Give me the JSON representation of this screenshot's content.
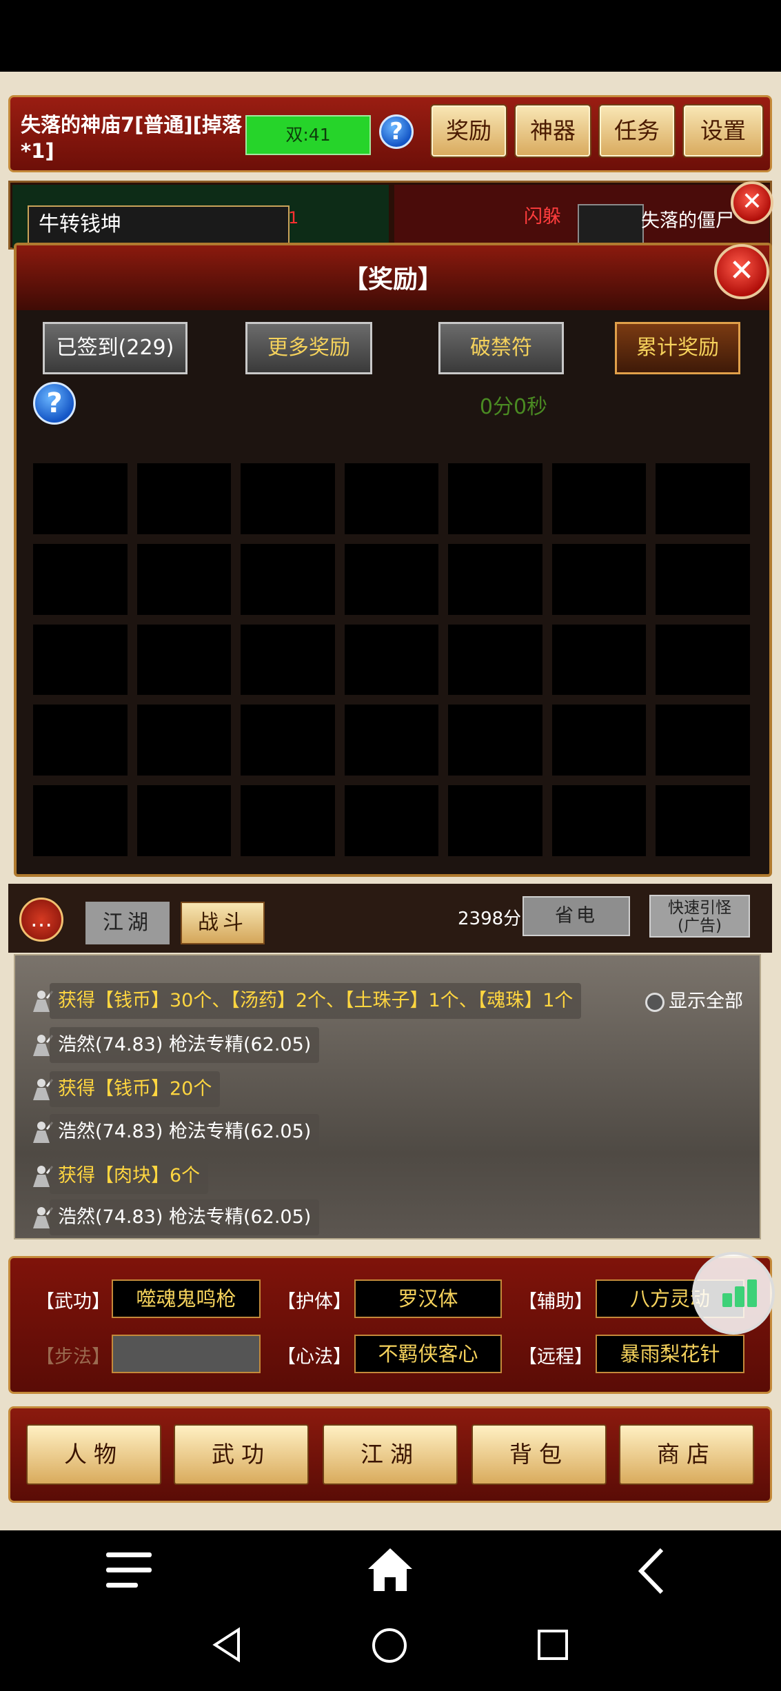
{
  "header": {
    "map_title": "失落的神庙7[普通][掉落*1]",
    "double_text": "双:41",
    "help_symbol": "?",
    "buttons": [
      "奖励",
      "神器",
      "任务",
      "设置"
    ]
  },
  "battle": {
    "ally_name": "牛转钱坤",
    "ally_marker": "1",
    "dodge_text": "闪躲",
    "enemy_name": "失落的僵尸"
  },
  "modal": {
    "title": "【奖励】",
    "tabs": [
      "已签到(229)",
      "更多奖励",
      "破禁符",
      "累计奖励"
    ],
    "timer": "0分0秒",
    "grid_rows": 5,
    "grid_cols": 7
  },
  "chat": {
    "tabs": [
      "江湖",
      "战斗"
    ],
    "score": "2398分",
    "save_button": "省电",
    "quick_button": "快速引怪\n(广告)",
    "show_all": "显示全部",
    "logs": [
      {
        "text": "获得【钱币】30个、【汤药】2个、【土珠子】1个、【魂珠】1个",
        "type": "gold"
      },
      {
        "text": "浩然(74.83) 枪法专精(62.05)",
        "type": "white"
      },
      {
        "text": "获得【钱币】20个",
        "type": "gold"
      },
      {
        "text": "浩然(74.83) 枪法专精(62.05)",
        "type": "white"
      },
      {
        "text": "获得【肉块】6个",
        "type": "gold"
      },
      {
        "text": "浩然(74.83) 枪法专精(62.05)",
        "type": "white"
      }
    ]
  },
  "skills": {
    "labels": [
      "【武功】",
      "【护体】",
      "【辅助】",
      "【步法】",
      "【心法】",
      "【远程】"
    ],
    "values": [
      "噬魂鬼鸣枪",
      "罗汉体",
      "八方灵动",
      "",
      "不羁侠客心",
      "暴雨梨花针"
    ]
  },
  "nav": [
    "人物",
    "武功",
    "江湖",
    "背包",
    "商店"
  ],
  "icons": {
    "close": "close-icon",
    "chat": "chat-bubble-icon",
    "signal": "signal-bars-icon",
    "menu": "menu-icon",
    "home": "home-icon",
    "back": "chevron-left-icon"
  },
  "colors": {
    "frame_red": "#8b1a0e",
    "gold": "#f5d25c",
    "green": "#26d42a"
  }
}
